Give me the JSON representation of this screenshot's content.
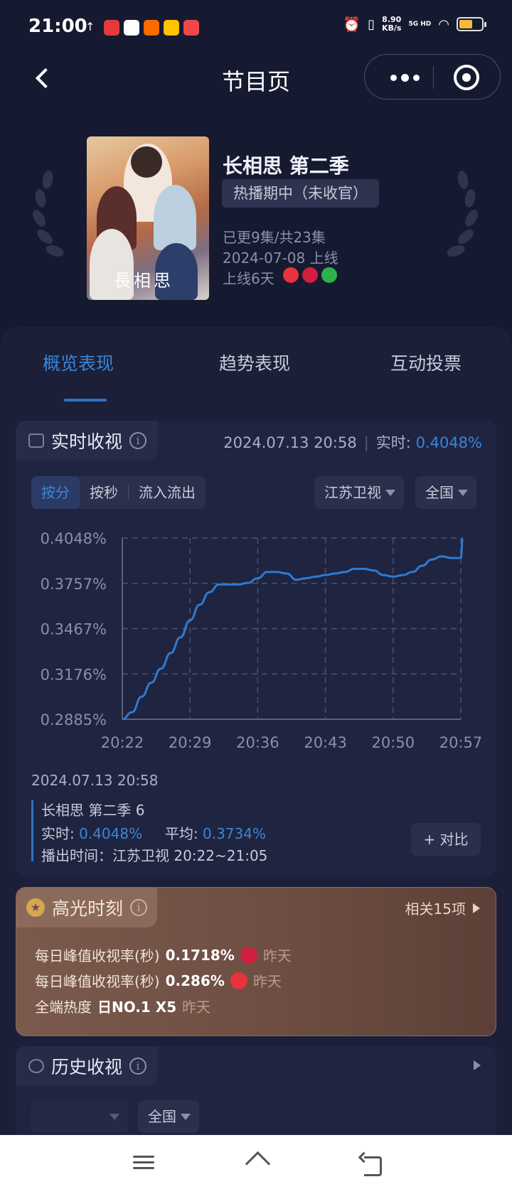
{
  "status_bar": {
    "time": "21:00",
    "network_speed_value": "8.90",
    "network_speed_unit": "KB/s",
    "network_type": "5G HD",
    "battery_level": 0.6
  },
  "nav": {
    "title": "节目页"
  },
  "show": {
    "name": "长相思 第二季",
    "status": "热播期中（未收官）",
    "episodes": "已更9集/共23集",
    "release_date": "2024-07-08 上线",
    "days_online": "上线6天",
    "poster_title": "長相思",
    "platform_icons": [
      "mango-icon",
      "star-icon",
      "iqiyi-icon"
    ]
  },
  "tabs": [
    {
      "label": "概览表现",
      "active": true
    },
    {
      "label": "趋势表现",
      "active": false
    },
    {
      "label": "互动投票",
      "active": false
    }
  ],
  "realtime": {
    "title": "实时收视",
    "timestamp": "2024.07.13 20:58",
    "realtime_label": "实时:",
    "realtime_value": "0.4048%",
    "segments": [
      "按分",
      "按秒",
      "流入流出"
    ],
    "active_segment": "按分",
    "channel": "江苏卫视",
    "region": "全国"
  },
  "chart_data": {
    "type": "line",
    "title": "",
    "xlabel": "",
    "ylabel": "",
    "x_ticks": [
      "20:22",
      "20:29",
      "20:36",
      "20:43",
      "20:50",
      "20:57"
    ],
    "y_ticks": [
      "0.2885%",
      "0.3176%",
      "0.3467%",
      "0.3757%",
      "0.4048%"
    ],
    "ylim": [
      0.2885,
      0.4048
    ],
    "grid": true,
    "x": [
      "20:22",
      "20:23",
      "20:24",
      "20:25",
      "20:26",
      "20:27",
      "20:28",
      "20:29",
      "20:30",
      "20:31",
      "20:32",
      "20:33",
      "20:34",
      "20:35",
      "20:36",
      "20:37",
      "20:38",
      "20:39",
      "20:40",
      "20:41",
      "20:42",
      "20:43",
      "20:44",
      "20:45",
      "20:46",
      "20:47",
      "20:48",
      "20:49",
      "20:50",
      "20:51",
      "20:52",
      "20:53",
      "20:54",
      "20:55",
      "20:56",
      "20:57",
      "20:58"
    ],
    "series": [
      {
        "values": [
          0.2885,
          0.293,
          0.303,
          0.312,
          0.321,
          0.331,
          0.341,
          0.352,
          0.362,
          0.37,
          0.375,
          0.375,
          0.375,
          0.376,
          0.379,
          0.383,
          0.383,
          0.382,
          0.378,
          0.379,
          0.38,
          0.381,
          0.382,
          0.383,
          0.385,
          0.385,
          0.384,
          0.381,
          0.38,
          0.381,
          0.383,
          0.387,
          0.391,
          0.393,
          0.392,
          0.392,
          0.4048
        ]
      }
    ]
  },
  "realtime_detail": {
    "date": "2024.07.13 20:58",
    "episode": "长相思 第二季 6",
    "realtime_label": "实时:",
    "realtime_value": "0.4048%",
    "avg_label": "平均:",
    "avg_value": "0.3734%",
    "airtime": "播出时间：江苏卫视 20:22~21:05",
    "compare_button": "+ 对比"
  },
  "highlights": {
    "title": "高光时刻",
    "more": "相关15项",
    "rows": [
      {
        "label": "每日峰值收视率(秒)",
        "value": "0.1718%",
        "icon": "star-tv-logo-icon",
        "when": "昨天"
      },
      {
        "label": "每日峰值收视率(秒)",
        "value": "0.286%",
        "icon": "mango-tv-logo-icon",
        "when": "昨天"
      },
      {
        "label": "全端热度",
        "value": "日NO.1 X5",
        "when": "昨天"
      }
    ]
  },
  "history": {
    "title": "历史收视",
    "region": "全国"
  },
  "colors": {
    "accent": "#3b86d6",
    "background": "#161a30",
    "panel": "#1b1f38",
    "highlight_card": "#6f4f43"
  }
}
